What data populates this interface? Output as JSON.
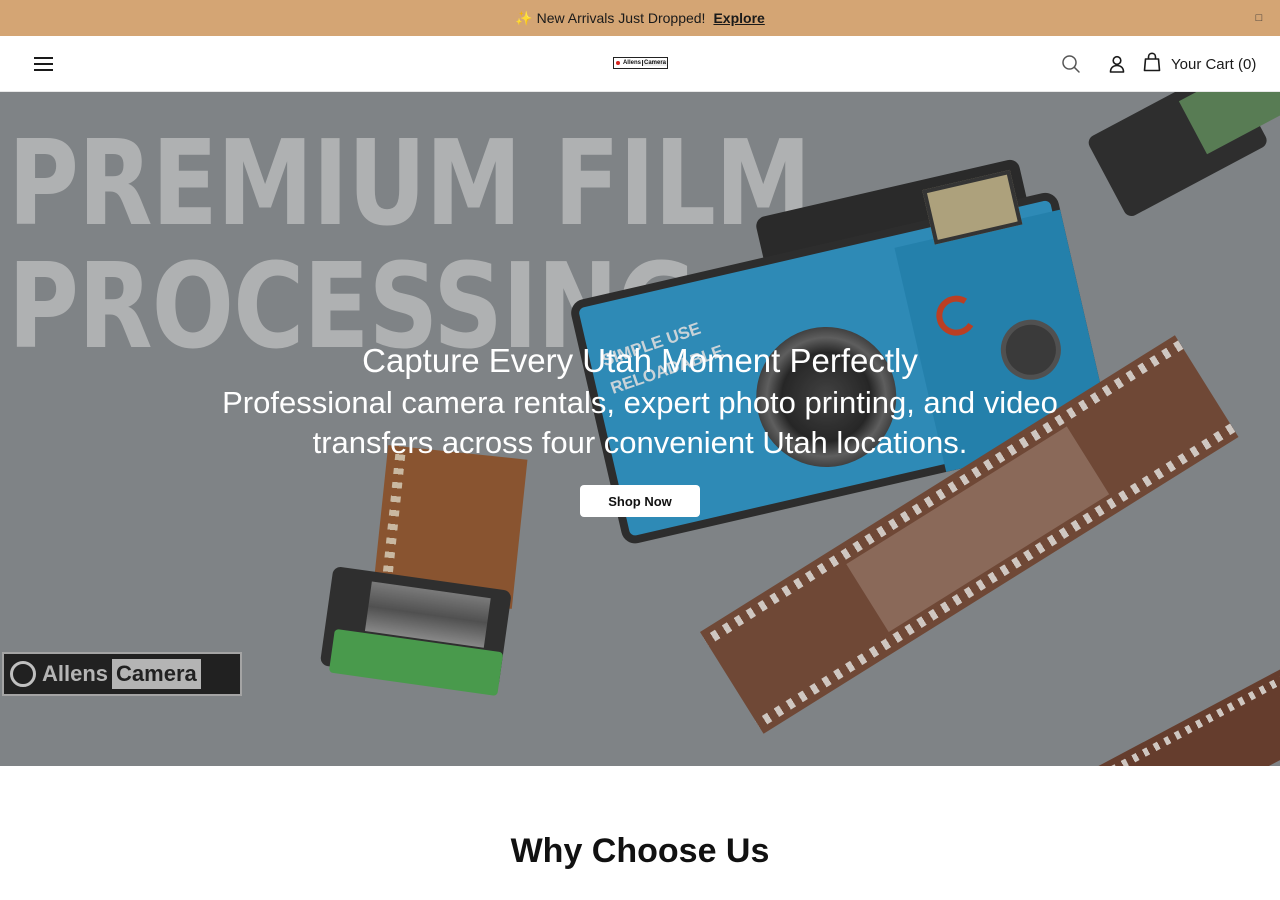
{
  "announcement": {
    "sparkle": "✨",
    "message": "New Arrivals Just Dropped!",
    "link_label": "Explore",
    "close_icon": "close-icon",
    "background": "#d4a574"
  },
  "header": {
    "menu_icon": "hamburger-menu-icon",
    "logo": {
      "part1": "Allens",
      "part2": "Camera",
      "accent": "#d6241f"
    },
    "search_icon": "search-icon",
    "account_icon": "user-icon",
    "cart_icon": "shopping-bag-icon",
    "cart_label": "Your Cart (0)"
  },
  "hero": {
    "background_text_line1": "PREMIUM FILM",
    "background_text_line2": "PROCESSING",
    "title": "Capture Every Utah Moment Perfectly",
    "subtitle": "Professional camera rentals, expert photo printing, and video transfers across four convenient Utah locations.",
    "cta_label": "Shop Now",
    "camera_label1": "SIMPLE USE",
    "camera_label2": "RELOADABLE",
    "stamp_word1": "Allens",
    "stamp_word2": "Camera"
  },
  "why": {
    "title": "Why Choose Us"
  }
}
